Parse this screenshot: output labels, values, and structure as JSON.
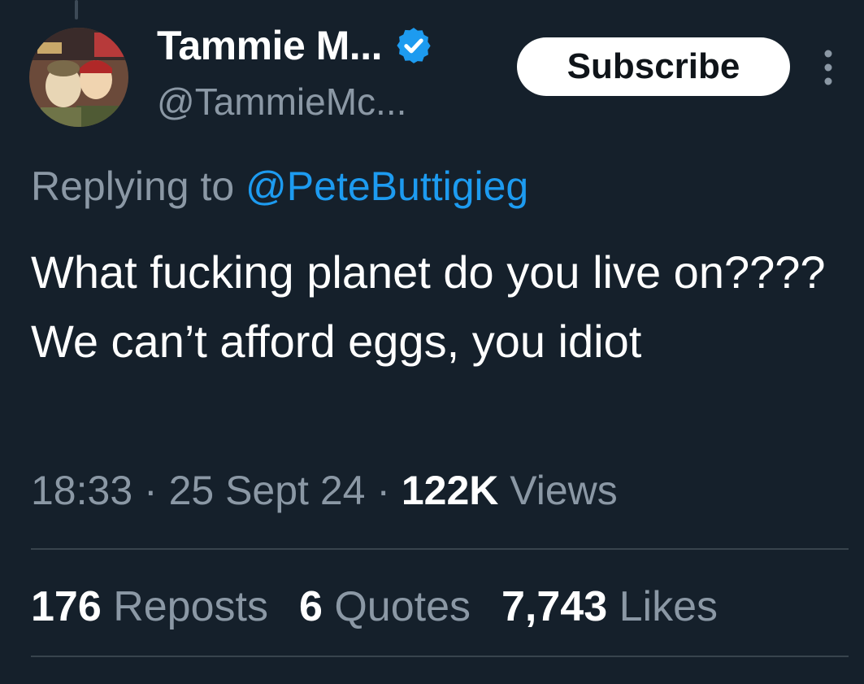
{
  "author": {
    "display_name": "Tammie M...",
    "handle": "@TammieMc..."
  },
  "header": {
    "subscribe_label": "Subscribe"
  },
  "reply": {
    "prefix": "Replying to ",
    "mention": "@PeteButtigieg"
  },
  "tweet": {
    "text": "What fucking planet do you live on???? We can’t afford eggs, you idiot"
  },
  "meta": {
    "time": "18:33",
    "separator": " · ",
    "date": "25 Sept 24",
    "views_count": "122K",
    "views_label": " Views"
  },
  "stats": {
    "reposts_count": "176",
    "reposts_label": " Reposts",
    "quotes_count": "6",
    "quotes_label": " Quotes",
    "likes_count": "7,743",
    "likes_label": " Likes"
  },
  "icons": {
    "verified": "verified-badge-icon",
    "more": "more-vertical-icon"
  },
  "colors": {
    "background": "#15202b",
    "accent": "#1d9bf0",
    "muted_text": "#8b98a5",
    "divider": "#38444d"
  }
}
